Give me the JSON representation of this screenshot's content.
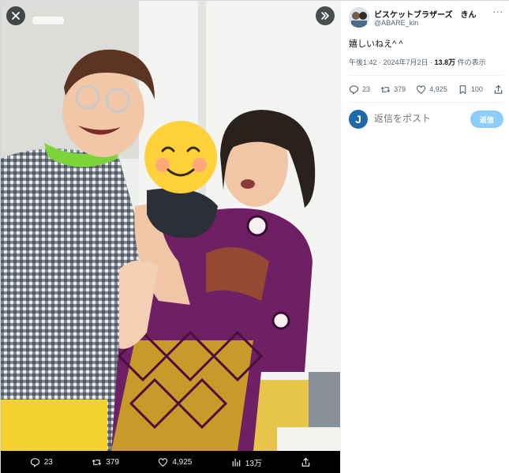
{
  "viewer": {
    "close_icon": "close-icon",
    "expand_icon": "expand-panel-icon",
    "bar": {
      "replies": "23",
      "reposts": "379",
      "likes": "4,925",
      "views": "13万"
    }
  },
  "tweet": {
    "display_name": "ビスケットブラザーズ　きん",
    "handle": "@ABARE_kin",
    "more_label": "···",
    "text": "嬉しいねえ^ ^",
    "time": "午後1:42 · 2024年7月2日 · ",
    "views_count": "13.8万",
    "views_suffix": " 件の表示",
    "stats": {
      "replies": "23",
      "reposts": "379",
      "likes": "4,925",
      "bookmarks": "100"
    }
  },
  "reply_box": {
    "avatar_letter": "J",
    "placeholder": "返信をポスト",
    "button_label": "返信"
  },
  "colors": {
    "accent": "#1d9bf0",
    "reply_button_disabled": "#8ecdf8",
    "text_primary": "#0f1419",
    "text_secondary": "#536471"
  }
}
